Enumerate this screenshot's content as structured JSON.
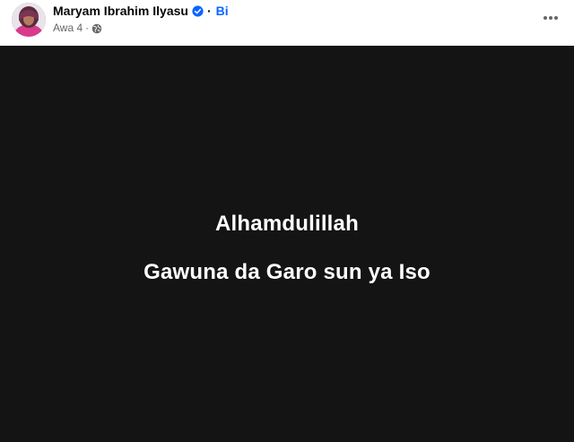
{
  "post": {
    "author_name": "Maryam Ibrahim Ilyasu",
    "separator": "·",
    "follow_label": "Bi",
    "timestamp": "Awa 4",
    "meta_separator": "·",
    "privacy_icon": "globe-icon",
    "verified_icon": "verified-badge-icon",
    "more_icon": "more-options-icon"
  },
  "content": {
    "line1": "Alhamdulillah",
    "line2": "Gawuna da Garo sun ya Iso",
    "background_color": "#141414",
    "text_color": "#ffffff"
  },
  "colors": {
    "link_blue": "#0866ff",
    "verified_blue": "#0866ff",
    "secondary_text": "#65676b"
  }
}
